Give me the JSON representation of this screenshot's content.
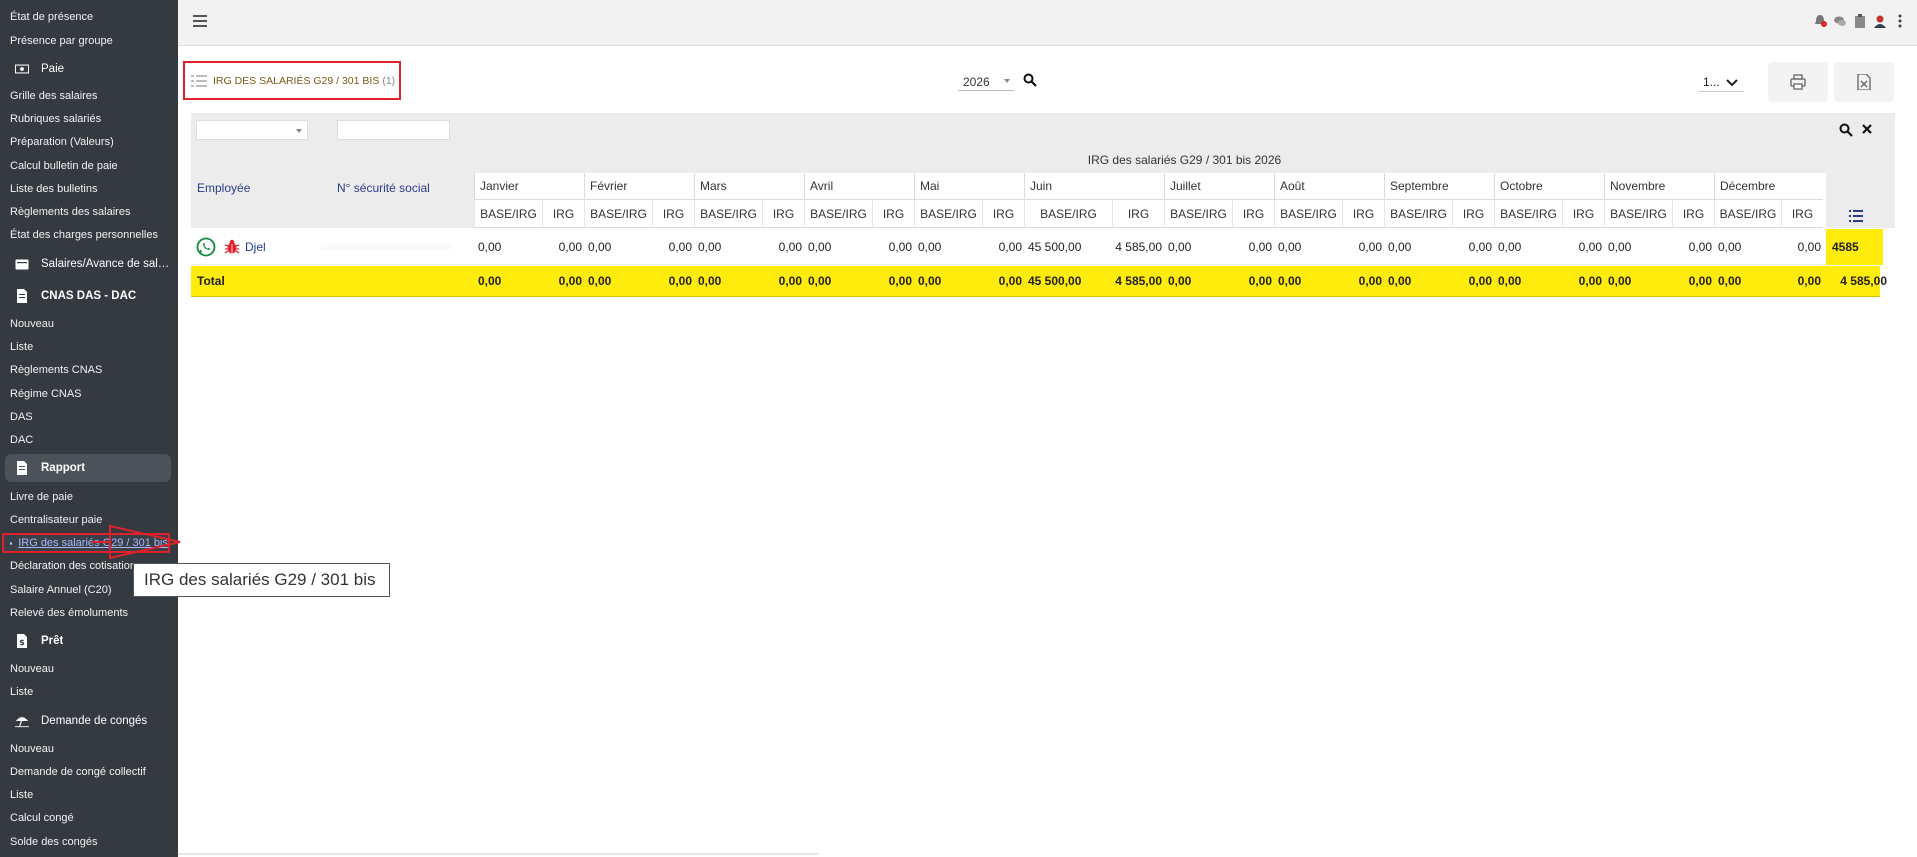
{
  "sidebar": {
    "items_top": [
      {
        "label": "État de présence"
      },
      {
        "label": "Présence par groupe"
      }
    ],
    "sections": {
      "paie": "Paie",
      "salaires": "Salaires/Avance de salai...",
      "cnas": "CNAS DAS - DAC",
      "rapport": "Rapport",
      "pret": "Prêt",
      "conges": "Demande de congés"
    },
    "paie_items": [
      "Grille des salaires",
      "Rubriques salariés",
      "Préparation (Valeurs)",
      "Calcul bulletin de paie",
      "Liste des bulletins",
      "Règlements des salaires",
      "État des charges personnelles"
    ],
    "cnas_items": [
      "Nouveau",
      "Liste",
      "Règlements CNAS",
      "Régime CNAS",
      "DAS",
      "DAC"
    ],
    "rapport_items": [
      "Livre de paie",
      "Centralisateur paie"
    ],
    "rapport_current": "IRG des salariés G29 / 301 bis",
    "rapport_items_after": [
      "Déclaration des cotisation",
      "Salaire Annuel (C20)",
      "Relevé des émoluments"
    ],
    "pret_items": [
      "Nouveau",
      "Liste"
    ],
    "conges_items": [
      "Nouveau",
      "Demande de congé collectif",
      "Liste",
      "Calcul congé",
      "Solde des congés"
    ]
  },
  "tooltip": "IRG des salariés G29 / 301 bis",
  "header": {
    "title": "IRG DES SALARIÉS G29 / 301 BIS",
    "count": "(1)",
    "year": "2026",
    "page": "1..."
  },
  "table": {
    "caption": "IRG des salariés G29 / 301 bis 2026",
    "col_employee": "Employée",
    "col_ssn": "N° sécurité social",
    "months": [
      "Janvier",
      "Février",
      "Mars",
      "Avril",
      "Mai",
      "Juin",
      "Juillet",
      "Août",
      "Septembre",
      "Octobre",
      "Novembre",
      "Décembre"
    ],
    "sub_base": "BASE/IRG",
    "sub_irg": "IRG",
    "rows": [
      {
        "name": "Djel",
        "values": [
          "0,00",
          "0,00",
          "0,00",
          "0,00",
          "0,00",
          "0,00",
          "0,00",
          "0,00",
          "0,00",
          "0,00",
          "45 500,00",
          "4 585,00",
          "0,00",
          "0,00",
          "0,00",
          "0,00",
          "0,00",
          "0,00",
          "0,00",
          "0,00",
          "0,00",
          "0,00",
          "0,00",
          "0,00"
        ],
        "total": "4585"
      }
    ],
    "total_label": "Total",
    "total_values": [
      "0,00",
      "0,00",
      "0,00",
      "0,00",
      "0,00",
      "0,00",
      "0,00",
      "0,00",
      "0,00",
      "0,00",
      "45 500,00",
      "4 585,00",
      "0,00",
      "0,00",
      "0,00",
      "0,00",
      "0,00",
      "0,00",
      "0,00",
      "0,00",
      "0,00",
      "0,00",
      "0,00",
      "0,00"
    ],
    "grand_total": "4 585,00"
  },
  "colors": {
    "sidebar_bg": "#343a40",
    "highlight_red": "#e0202a",
    "total_yellow": "#ffeb0c",
    "link_blue": "#2a3c8e"
  }
}
